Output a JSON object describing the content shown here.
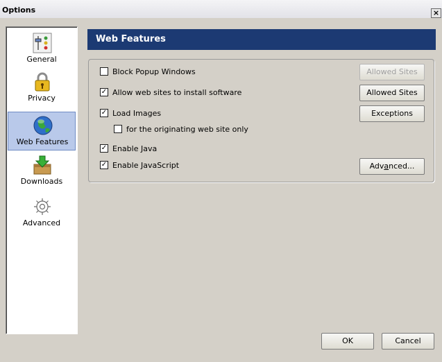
{
  "window": {
    "title": "Options",
    "close_glyph": "×"
  },
  "sidebar": {
    "items": [
      {
        "label": "General",
        "icon": "general-icon",
        "selected": false
      },
      {
        "label": "Privacy",
        "icon": "lock-icon",
        "selected": false
      },
      {
        "label": "Web Features",
        "icon": "globe-icon",
        "selected": true
      },
      {
        "label": "Downloads",
        "icon": "download-box-icon",
        "selected": false
      },
      {
        "label": "Advanced",
        "icon": "gear-icon",
        "selected": false
      }
    ]
  },
  "panel": {
    "title": "Web Features",
    "options": [
      {
        "label": "Block Popup Windows",
        "checked": false
      },
      {
        "label": "Allow web sites to install software",
        "checked": true
      },
      {
        "label": "Load Images",
        "checked": true
      },
      {
        "label": "for the originating web site only",
        "checked": false
      },
      {
        "label": "Enable Java",
        "checked": true
      },
      {
        "label": "Enable JavaScript",
        "checked": true
      }
    ],
    "buttons": {
      "allowed_sites_popup": {
        "label": "Allowed Sites",
        "enabled": false
      },
      "allowed_sites_install": {
        "label": "Allowed Sites",
        "enabled": true
      },
      "exceptions": {
        "label": "Exceptions",
        "enabled": true
      },
      "advanced_pre": "Adv",
      "advanced_accel": "a",
      "advanced_post": "nced..."
    }
  },
  "footer": {
    "ok": "OK",
    "cancel": "Cancel"
  },
  "colors": {
    "header_bg": "#1c3a73",
    "dialog_bg": "#d4d0c8",
    "selected_bg": "#b9c9ea"
  }
}
